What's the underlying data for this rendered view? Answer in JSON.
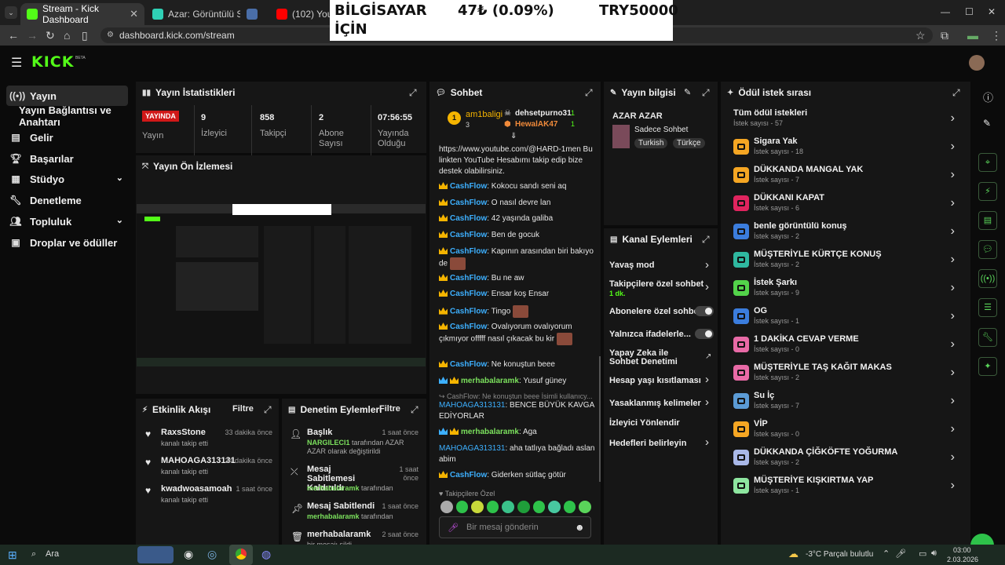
{
  "browser": {
    "tabs": [
      {
        "title": "Stream - Kick Dashboard",
        "active": true
      },
      {
        "title": "Azar: Görüntülü Sohbet & V",
        "active": false
      },
      {
        "title": "",
        "active": false
      },
      {
        "title": "(102) YouTube",
        "active": false
      }
    ],
    "url": "dashboard.kick.com/stream"
  },
  "ticker": {
    "left": "BİLGİSAYAR",
    "left2": "İÇİN",
    "mid": "47₺ (0.09%)",
    "right": "TRY50000"
  },
  "app": {
    "logo": "KICK",
    "logo_badge": "BETA"
  },
  "sidebar": {
    "items": [
      {
        "label": "Yayın",
        "icon": "broadcast-icon"
      },
      {
        "label": "Yayın Bağlantısı ve Anahtarı",
        "icon": ""
      },
      {
        "label": "Gelir",
        "icon": "revenue-icon"
      },
      {
        "label": "Başarılar",
        "icon": "trophy-icon"
      },
      {
        "label": "Stüdyo",
        "icon": "studio-icon"
      },
      {
        "label": "Denetleme",
        "icon": "wrench-icon"
      },
      {
        "label": "Topluluk",
        "icon": "community-icon"
      },
      {
        "label": "Droplar ve ödüller",
        "icon": "gift-icon"
      }
    ]
  },
  "stats": {
    "title": "Yayın İstatistikleri",
    "live_badge": "YAYINDA",
    "live_label": "Yayın",
    "items": [
      {
        "value": "9",
        "label": "İzleyici"
      },
      {
        "value": "858",
        "label": "Takipçi"
      },
      {
        "value": "2",
        "label": "Abone Sayısı"
      },
      {
        "value": "07:56:55",
        "label": "Yayında Olduğu Süre"
      }
    ]
  },
  "preview": {
    "title": "Yayın Ön İzlemesi"
  },
  "chat": {
    "title": "Sohbet",
    "pinned": [
      {
        "name": "am1baligi",
        "count": "3"
      },
      {
        "name": "dehsetpurno31",
        "count": "1"
      },
      {
        "name": "HewalAK47",
        "count": "1"
      }
    ],
    "messages": [
      {
        "user": "",
        "text": "https://www.youtube.com/@HARD-1men Bu linkten YouTube Hesabımı takip edip bize destek olabilirsiniz."
      },
      {
        "user": "CashFlow",
        "text": ": Kokocu sandı seni aq"
      },
      {
        "user": "CashFlow",
        "text": ": O nasıl devre lan"
      },
      {
        "user": "CashFlow",
        "text": ": 42 yaşında galiba"
      },
      {
        "user": "CashFlow",
        "text": ": Ben de gocuk"
      },
      {
        "user": "CashFlow",
        "text": ": Kapının arasından biri bakıyo de"
      },
      {
        "user": "CashFlow",
        "text": ": Bu ne aw"
      },
      {
        "user": "CashFlow",
        "text": ": Ensar koş Ensar"
      },
      {
        "user": "CashFlow",
        "text": ": Tingo"
      },
      {
        "user": "CashFlow",
        "text": ": Ovalıyorum ovalıyorum çıkmıyor offfff nasıl çıkacak bu kir"
      },
      {
        "user": "CashFlow",
        "text": ": Ne konuştun beee"
      },
      {
        "user": "merhabalaramk",
        "text": ": Yusuf güney"
      },
      {
        "user": "",
        "text": "CashFlow: Ne konuştun beee İsimli kullanıcy..."
      },
      {
        "user": "MAHOAGA313131",
        "text": ": BENCE BÜYÜK KAVGA EDİYORLAR"
      },
      {
        "user": "merhabalaramk",
        "text": ": Aga"
      },
      {
        "user": "MAHOAGA313131",
        "text": ": aha tatlıya bağladı aslan abim"
      },
      {
        "user": "CashFlow",
        "text": ": Giderken sütlaç götür"
      }
    ],
    "followers_label": "Takipçilere Özel",
    "input_placeholder": "Bir mesaj gönderin"
  },
  "stream_info": {
    "title": "Yayın bilgisi",
    "name": "AZAR AZAR",
    "category": "Sadece Sohbet",
    "tags": [
      "Turkish",
      "Türkçe"
    ]
  },
  "channel_actions": {
    "title": "Kanal Eylemleri",
    "items": [
      {
        "label": "Yavaş mod",
        "sub": ""
      },
      {
        "label": "Takipçilere özel sohbet",
        "sub": "1 dk."
      },
      {
        "label": "Abonelere özel sohbet",
        "sub": ""
      },
      {
        "label": "Yalnızca ifadelerle...",
        "sub": ""
      },
      {
        "label": "Yapay Zeka ile Sohbet Denetimi",
        "sub": ""
      },
      {
        "label": "Hesap yaşı kısıtlaması",
        "sub": ""
      },
      {
        "label": "Yasaklanmış kelimeler",
        "sub": ""
      },
      {
        "label": "İzleyici Yönlendir",
        "sub": ""
      },
      {
        "label": "Hedefleri belirleyin",
        "sub": ""
      }
    ]
  },
  "rewards": {
    "title": "Ödül istek sırası",
    "all_label": "Tüm ödül istekleri",
    "all_sub": "İstek sayısı - 57",
    "items": [
      {
        "title": "Sigara Yak",
        "sub": "İstek sayısı - 18",
        "color": "#f5a623"
      },
      {
        "title": "DÜKKANDA MANGAL YAK",
        "sub": "İstek sayısı - 7",
        "color": "#f5a623"
      },
      {
        "title": "DÜKKANI KAPAT",
        "sub": "İstek sayısı - 6",
        "color": "#e0245e"
      },
      {
        "title": "benle görüntülü konuş",
        "sub": "İstek sayısı - 2",
        "color": "#3b7ddd"
      },
      {
        "title": "MÜŞTERİYLE KÜRTÇE KONUŞ",
        "sub": "İstek sayısı - 2",
        "color": "#2fb8a0"
      },
      {
        "title": "İstek Şarkı",
        "sub": "İstek sayısı - 9",
        "color": "#53d34a"
      },
      {
        "title": "OG",
        "sub": "İstek sayısı - 1",
        "color": "#3b7ddd"
      },
      {
        "title": "1 DAKİKA CEVAP VERME",
        "sub": "İstek sayısı - 0",
        "color": "#e86aa6"
      },
      {
        "title": "MÜŞTERİYLE TAŞ KAĞIT MAKAS",
        "sub": "İstek sayısı - 2",
        "color": "#e86aa6"
      },
      {
        "title": "Su İç",
        "sub": "İstek sayısı - 7",
        "color": "#5b9bd5"
      },
      {
        "title": "VİP",
        "sub": "İstek sayısı - 0",
        "color": "#f5a623"
      },
      {
        "title": "DÜKKANDA ÇİĞKÖFTE YOĞURMA",
        "sub": "İstek sayısı - 2",
        "color": "#a9b8e8"
      },
      {
        "title": "MÜŞTERİYE KIŞKIRTMA YAP",
        "sub": "İstek sayısı - 1",
        "color": "#8ee6a0"
      }
    ]
  },
  "activity": {
    "title": "Etkinlik Akışı",
    "filter": "Filtre",
    "items": [
      {
        "name": "RaxsStone",
        "sub": "kanalı takip etti",
        "time": "33 dakika önce"
      },
      {
        "name": "MAHOAGA313131",
        "sub": "kanalı takip etti",
        "time": "34 dakika önce"
      },
      {
        "name": "kwadwoasamoah",
        "sub": "kanalı takip etti",
        "time": "1 saat önce"
      }
    ]
  },
  "moderation": {
    "title": "Denetim Eylemleri",
    "filter": "Filtre",
    "items": [
      {
        "name": "Başlık",
        "actor": "NARGILECI1",
        "rest": " tarafından AZAR AZAR olarak değiştirildi",
        "time": "1 saat önce"
      },
      {
        "name": "Mesaj Sabitlemesi Kaldırıldı",
        "actor": "merhabalaramk",
        "rest": " tarafından",
        "time": "1 saat önce"
      },
      {
        "name": "Mesaj Sabitlendi",
        "actor": "merhabalaramk",
        "rest": " tarafından",
        "time": "1 saat önce"
      },
      {
        "name": "merhabalaramk",
        "actor": "",
        "rest": "bir mesajı sildi",
        "time": "2 saat önce"
      }
    ]
  },
  "taskbar": {
    "search": "Ara",
    "weather": "-3°C  Parçalı bulutlu",
    "time": "03:00",
    "date": "2.03.2026"
  }
}
